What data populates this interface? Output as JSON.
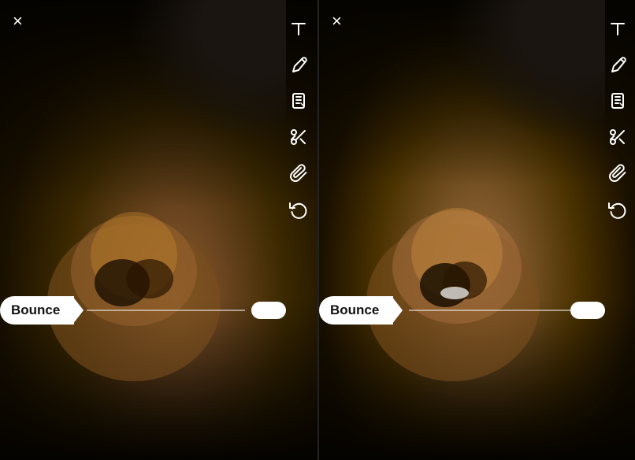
{
  "panels": [
    {
      "id": "left",
      "close_label": "×",
      "bounce_label": "Bounce",
      "toolbar": {
        "items": [
          {
            "name": "text-icon",
            "glyph": "T",
            "type": "text"
          },
          {
            "name": "pen-icon",
            "type": "pen"
          },
          {
            "name": "sticker-icon",
            "type": "sticker"
          },
          {
            "name": "scissors-icon",
            "type": "scissors"
          },
          {
            "name": "paperclip-icon",
            "type": "paperclip"
          },
          {
            "name": "redo-icon",
            "type": "redo"
          }
        ]
      }
    },
    {
      "id": "right",
      "close_label": "×",
      "bounce_label": "Bounce",
      "toolbar": {
        "items": [
          {
            "name": "text-icon",
            "glyph": "T",
            "type": "text"
          },
          {
            "name": "pen-icon",
            "type": "pen"
          },
          {
            "name": "sticker-icon",
            "type": "sticker"
          },
          {
            "name": "scissors-icon",
            "type": "scissors"
          },
          {
            "name": "paperclip-icon",
            "type": "paperclip"
          },
          {
            "name": "redo-icon",
            "type": "redo"
          }
        ]
      }
    }
  ]
}
